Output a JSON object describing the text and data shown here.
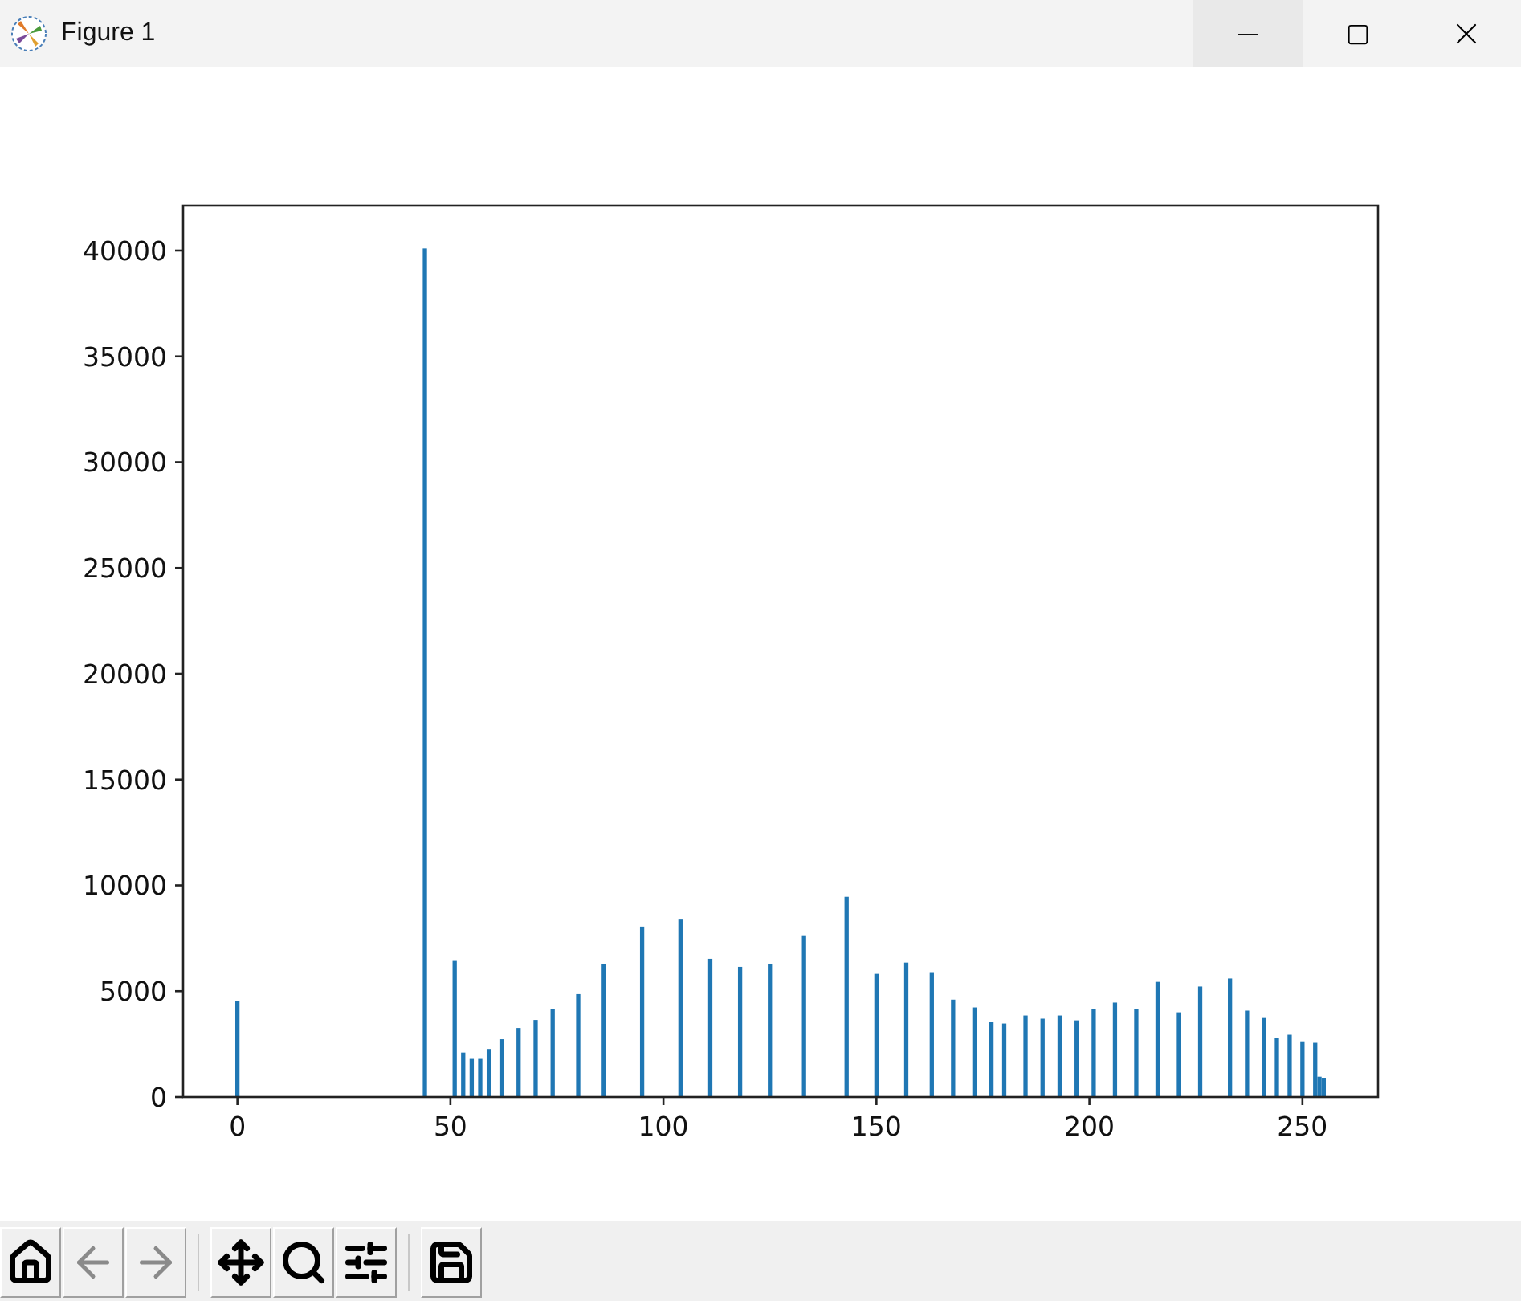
{
  "window": {
    "title": "Figure 1"
  },
  "chart_data": {
    "type": "bar",
    "x": [
      0,
      44,
      51,
      53,
      55,
      57,
      59,
      62,
      66,
      70,
      74,
      80,
      86,
      95,
      104,
      111,
      118,
      125,
      133,
      143,
      150,
      157,
      163,
      168,
      173,
      177,
      180,
      185,
      189,
      193,
      197,
      201,
      206,
      211,
      216,
      221,
      226,
      233,
      237,
      241,
      244,
      247,
      250,
      253,
      254,
      255
    ],
    "values": [
      4530,
      40100,
      6430,
      2100,
      1800,
      1800,
      2270,
      2730,
      3260,
      3640,
      4170,
      4860,
      6300,
      8050,
      8420,
      6530,
      6150,
      6300,
      7640,
      9460,
      5820,
      6350,
      5900,
      4600,
      4230,
      3540,
      3470,
      3850,
      3700,
      3850,
      3620,
      4150,
      4460,
      4150,
      5440,
      4000,
      5220,
      5600,
      4080,
      3770,
      2790,
      2940,
      2630,
      2560,
      960,
      910
    ],
    "xlim": [
      -12.75,
      267.75
    ],
    "ylim": [
      0,
      42125
    ],
    "xticks": [
      0,
      50,
      100,
      150,
      200,
      250
    ],
    "yticks": [
      0,
      5000,
      10000,
      15000,
      20000,
      25000,
      30000,
      35000,
      40000
    ]
  },
  "toolbar": [
    [
      {
        "kind": "home",
        "disabled": false
      },
      {
        "kind": "back",
        "disabled": true
      },
      {
        "kind": "forward",
        "disabled": true
      }
    ],
    [
      {
        "kind": "pan",
        "disabled": false
      },
      {
        "kind": "zoom",
        "disabled": false
      },
      {
        "kind": "configure",
        "disabled": false
      }
    ],
    [
      {
        "kind": "save",
        "disabled": false
      }
    ]
  ]
}
